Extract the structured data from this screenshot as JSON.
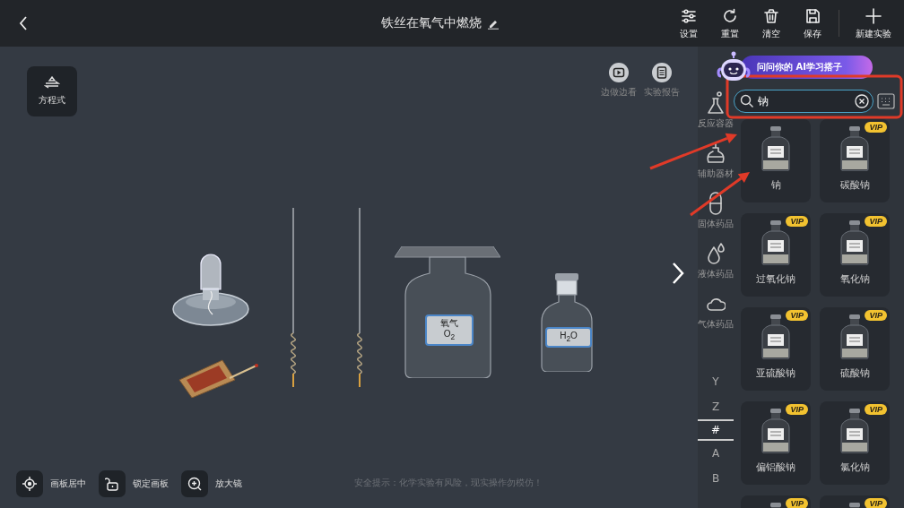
{
  "top_bar": {
    "title": "铁丝在氧气中燃烧",
    "actions": [
      {
        "kind": "settings",
        "label": "设置"
      },
      {
        "kind": "reset",
        "label": "重置"
      },
      {
        "kind": "clear",
        "label": "清空"
      },
      {
        "kind": "save",
        "label": "保存"
      },
      {
        "kind": "new",
        "label": "新建实验"
      }
    ]
  },
  "canvas": {
    "tool": {
      "label": "方程式"
    },
    "media_buttons": [
      {
        "kind": "video",
        "label": "边做边看"
      },
      {
        "kind": "report",
        "label": "实验报告"
      }
    ],
    "apparatus": [
      {
        "kind": "alcohol_lamp"
      },
      {
        "kind": "matchbox"
      },
      {
        "kind": "iron_wire"
      },
      {
        "kind": "iron_wire"
      },
      {
        "kind": "gas_jar",
        "label_lines": [
          "氧气",
          "O$_{2}$"
        ]
      },
      {
        "kind": "reagent_bottle",
        "label_lines": [
          "H$_{2}$O"
        ]
      }
    ],
    "bottom_tools": [
      {
        "kind": "center",
        "label": "画板居中"
      },
      {
        "kind": "lock",
        "label": "锁定画板"
      },
      {
        "kind": "zoom",
        "label": "放大镜"
      }
    ],
    "safety_notice": "安全提示：化学实验有风险，现实操作勿模仿！"
  },
  "panel": {
    "ai_banner": "问问你的 AI学习搭子",
    "search": {
      "value": "钠"
    },
    "categories": [
      {
        "kind": "flask",
        "label": "反应容器"
      },
      {
        "kind": "lamp",
        "label": "辅助器材"
      },
      {
        "kind": "capsule",
        "label": "固体药品"
      },
      {
        "kind": "drops",
        "label": "液体药品"
      },
      {
        "kind": "cloud",
        "label": "气体药品"
      }
    ],
    "index_letters": [
      {
        "letter": "Y",
        "selected": false
      },
      {
        "letter": "Z",
        "selected": false
      },
      {
        "letter": "#",
        "selected": true
      },
      {
        "letter": "A",
        "selected": false
      },
      {
        "letter": "B",
        "selected": false
      }
    ],
    "items": [
      {
        "name": "钠"
      },
      {
        "name": "碳酸钠",
        "badge": "VIP"
      },
      {
        "name": "过氧化钠",
        "badge": "VIP"
      },
      {
        "name": "氧化钠",
        "badge": "VIP"
      },
      {
        "name": "亚硫酸钠",
        "badge": "VIP"
      },
      {
        "name": "硫酸钠",
        "badge": "VIP"
      },
      {
        "name": "偏铝酸钠",
        "badge": "VIP"
      },
      {
        "name": "氯化钠",
        "badge": "VIP"
      },
      {
        "badge": "VIP"
      },
      {
        "badge": "VIP"
      }
    ]
  },
  "annotations": [
    {
      "kind": "frame"
    },
    {
      "kind": "arrow"
    },
    {
      "kind": "arrow"
    }
  ]
}
